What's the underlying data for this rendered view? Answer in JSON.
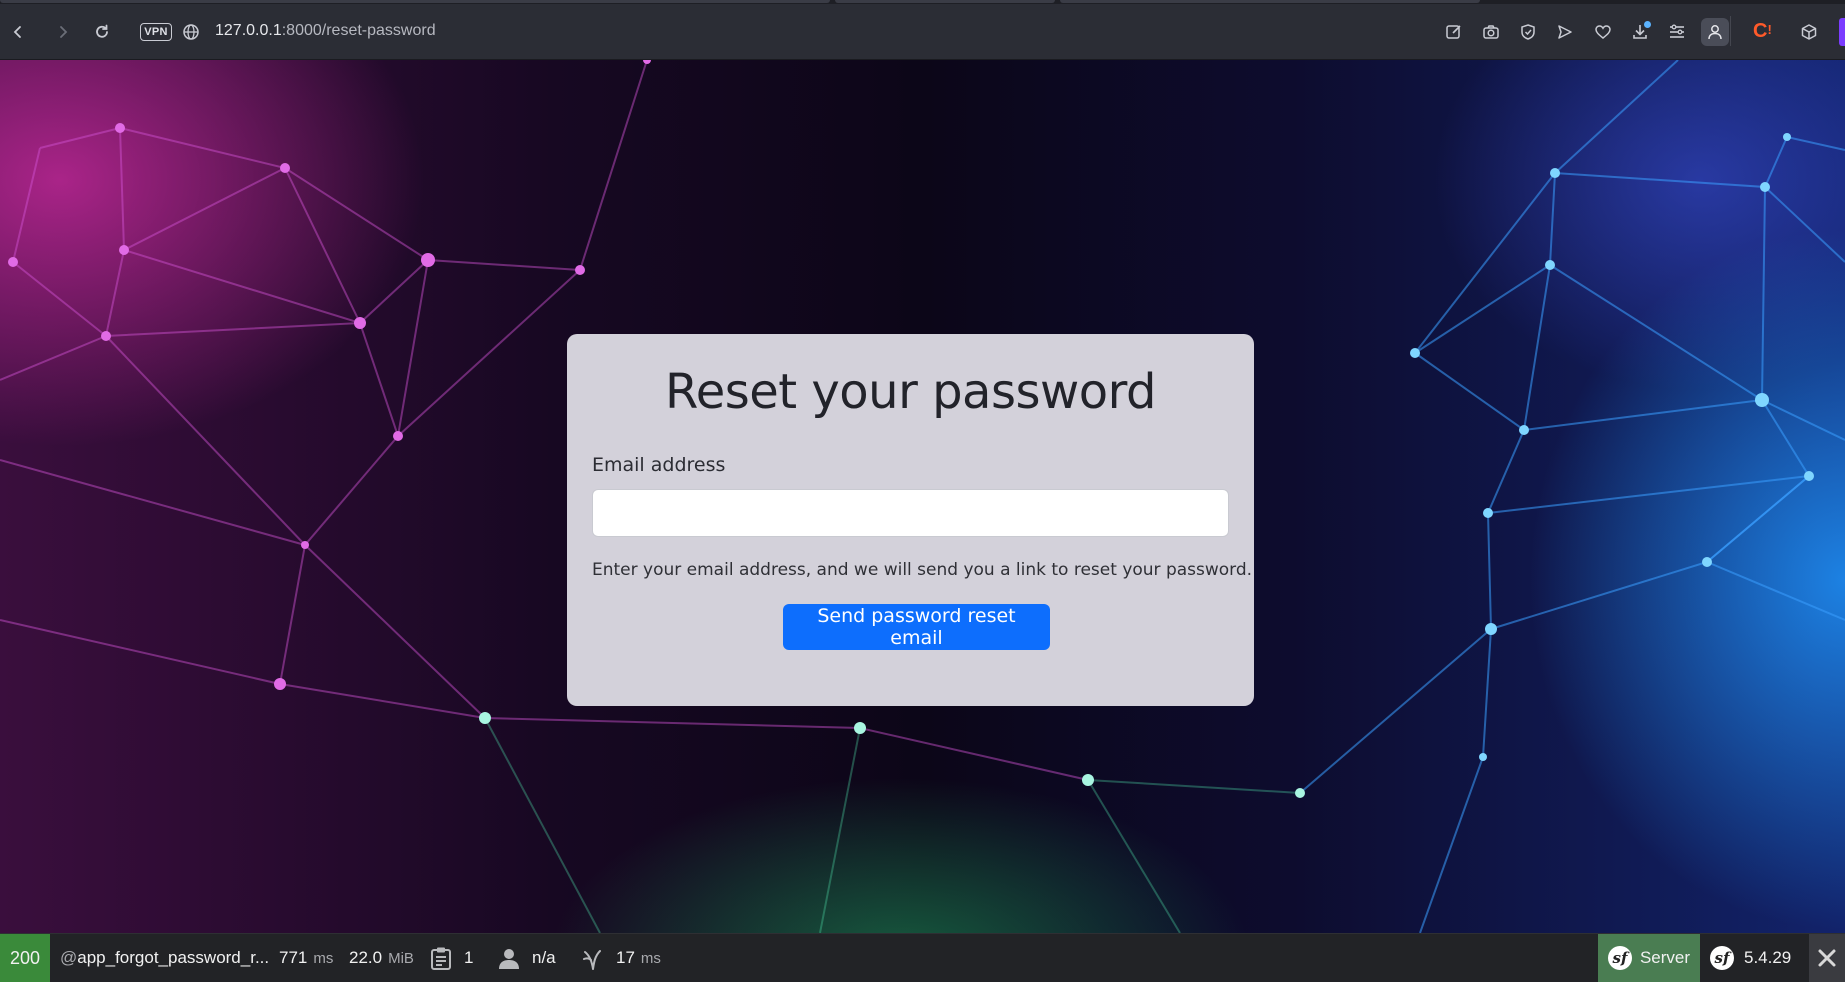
{
  "browser": {
    "vpn_label": "VPN",
    "url_host": "127.0.0.1",
    "url_path": ":8000/reset-password",
    "icons": {
      "back": "chevron-left-icon",
      "forward": "chevron-right-icon",
      "reload": "reload-icon",
      "site_info": "globe-icon",
      "edit": "edit-icon",
      "screenshot": "camera-icon",
      "shield": "shield-icon",
      "send": "send-icon",
      "favorites": "heart-icon",
      "downloads": "download-icon",
      "menu": "menu-icon",
      "profile": "profile-icon",
      "extension_c": "extension-icon",
      "box": "box-icon"
    }
  },
  "form": {
    "title": "Reset your password",
    "email_label": "Email address",
    "email_value": "",
    "help_text": "Enter your email address, and we will send you a link to reset your password.",
    "submit_label": "Send password reset email",
    "accent_color": "#0d6efd"
  },
  "toolbar": {
    "status_code": "200",
    "route_prefix": "@",
    "route": "app_forgot_password_r...",
    "time_value": "771",
    "time_unit": "ms",
    "memory_value": "22.0",
    "memory_unit": "MiB",
    "forms_count": "1",
    "user": "n/a",
    "twig_value": "17",
    "twig_unit": "ms",
    "server_label": "Server",
    "version": "5.4.29",
    "status_color": "#3a8a3a"
  }
}
